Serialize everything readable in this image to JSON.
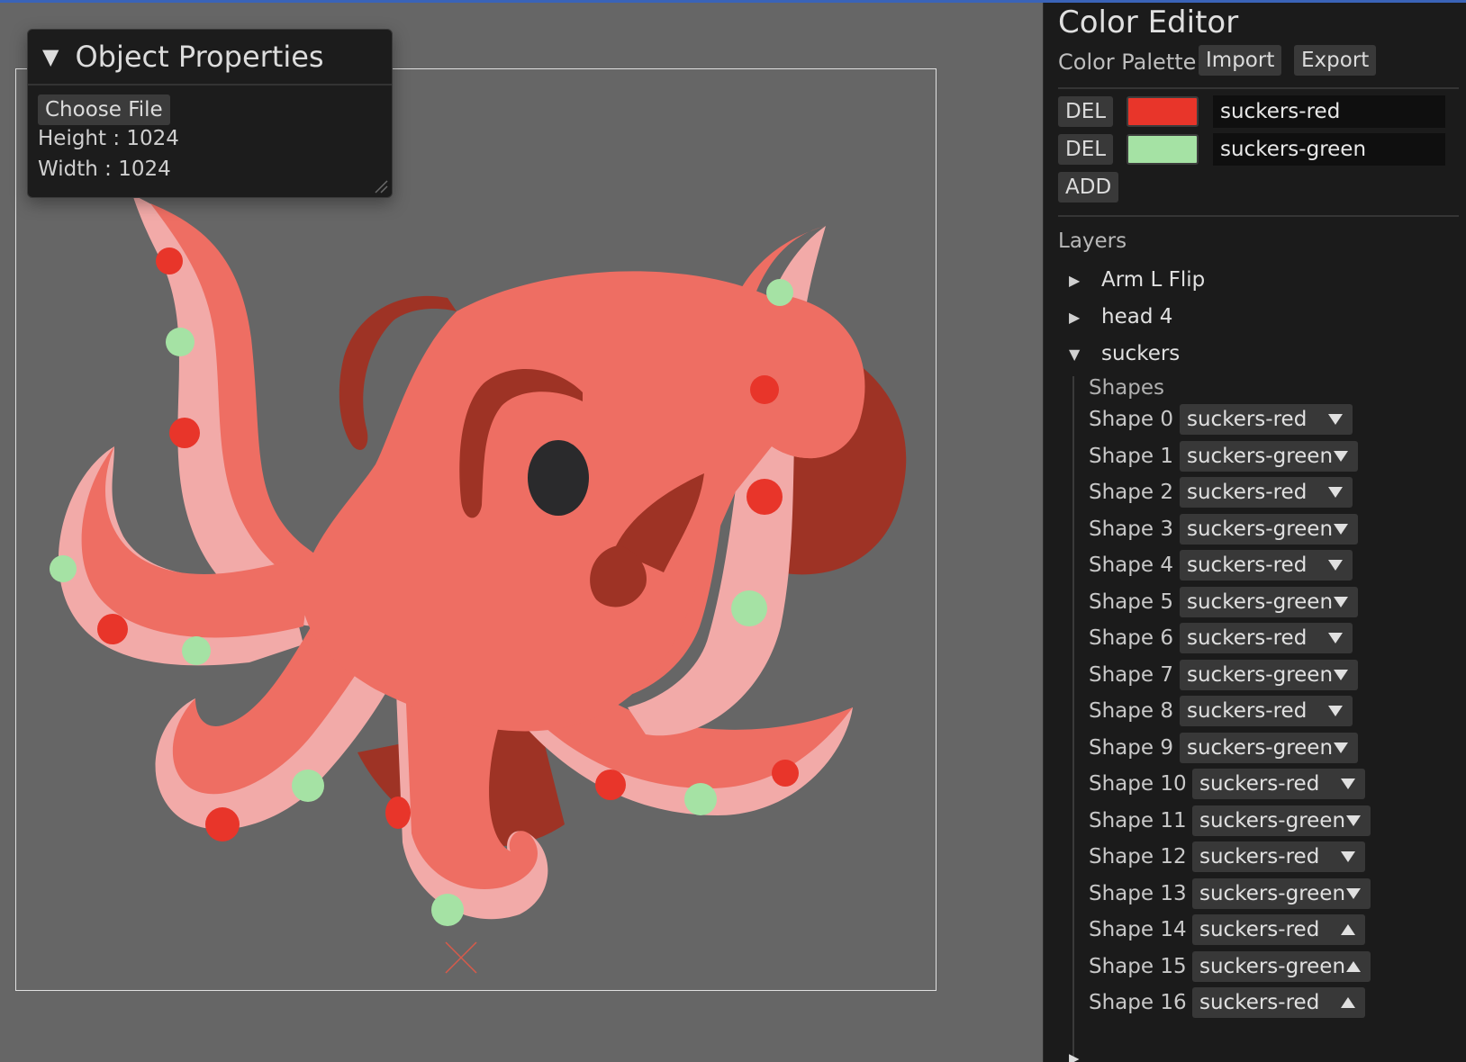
{
  "object_properties": {
    "title": "Object Properties",
    "choose_file": "Choose File",
    "height": "Height : 1024",
    "width": "Width : 1024"
  },
  "color_editor": {
    "title": "Color Editor",
    "palette_label": "Color Palette",
    "import_label": "Import",
    "export_label": "Export",
    "del_label": "DEL",
    "add_label": "ADD",
    "colors": [
      {
        "name": "suckers-red",
        "hex": "#e8352a"
      },
      {
        "name": "suckers-green",
        "hex": "#a5e2a4"
      }
    ]
  },
  "layers": {
    "label": "Layers",
    "items": [
      {
        "name": "Arm L Flip",
        "expanded": false
      },
      {
        "name": "head 4",
        "expanded": false
      },
      {
        "name": "suckers",
        "expanded": true
      }
    ],
    "shapes_label": "Shapes",
    "shapes": [
      {
        "label": "Shape 0",
        "color": "suckers-red",
        "open": false
      },
      {
        "label": "Shape 1",
        "color": "suckers-green",
        "open": false
      },
      {
        "label": "Shape 2",
        "color": "suckers-red",
        "open": false
      },
      {
        "label": "Shape 3",
        "color": "suckers-green",
        "open": false
      },
      {
        "label": "Shape 4",
        "color": "suckers-red",
        "open": false
      },
      {
        "label": "Shape 5",
        "color": "suckers-green",
        "open": false
      },
      {
        "label": "Shape 6",
        "color": "suckers-red",
        "open": false
      },
      {
        "label": "Shape 7",
        "color": "suckers-green",
        "open": false
      },
      {
        "label": "Shape 8",
        "color": "suckers-red",
        "open": false
      },
      {
        "label": "Shape 9",
        "color": "suckers-green",
        "open": false
      },
      {
        "label": "Shape 10",
        "color": "suckers-red",
        "open": false
      },
      {
        "label": "Shape 11",
        "color": "suckers-green",
        "open": false
      },
      {
        "label": "Shape 12",
        "color": "suckers-red",
        "open": false
      },
      {
        "label": "Shape 13",
        "color": "suckers-green",
        "open": false
      },
      {
        "label": "Shape 14",
        "color": "suckers-red",
        "open": true
      },
      {
        "label": "Shape 15",
        "color": "suckers-green",
        "open": true
      },
      {
        "label": "Shape 16",
        "color": "suckers-red",
        "open": true
      }
    ]
  },
  "colors": {
    "octopus_body": "#ee6e63",
    "octopus_dark": "#9e3325",
    "octopus_light": "#f2aaa8",
    "eye": "#2a2a2c",
    "panel_bg": "#1b1b1b",
    "canvas_bg": "#666666"
  }
}
